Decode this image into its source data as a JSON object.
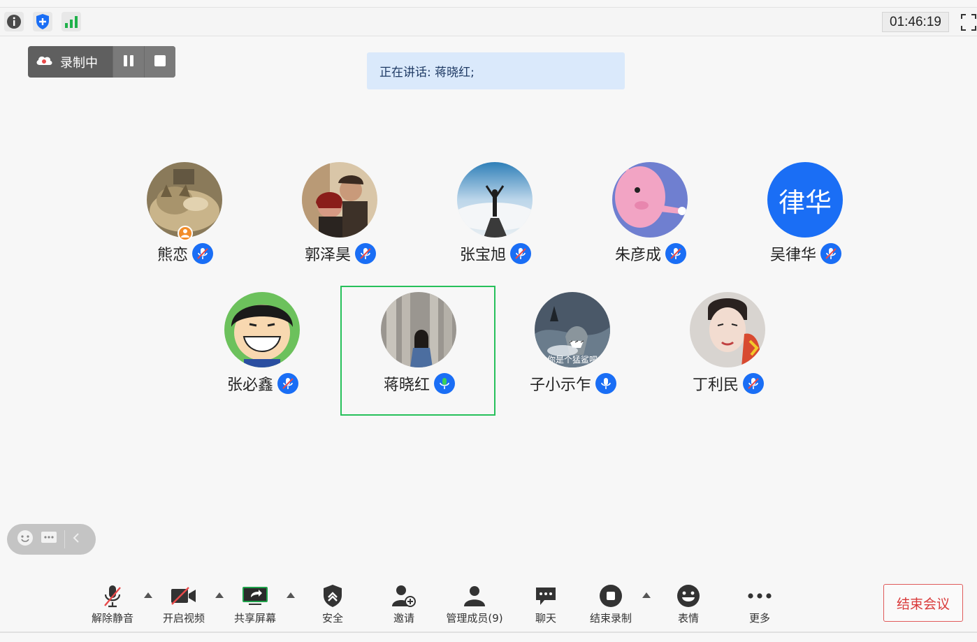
{
  "topbar": {
    "timer": "01:46:19",
    "icons": [
      "info-icon",
      "security-shield-icon",
      "signal-bars-icon",
      "fullscreen-icon"
    ]
  },
  "recording": {
    "status_label": "录制中",
    "pause": "pause-icon",
    "stop": "stop-icon"
  },
  "speaking_banner": "正在讲话: 蒋晓红;",
  "participants": [
    {
      "name": "熊恋",
      "mic": "muted",
      "host": true
    },
    {
      "name": "郭泽昊",
      "mic": "muted"
    },
    {
      "name": "张宝旭",
      "mic": "muted"
    },
    {
      "name": "朱彦成",
      "mic": "muted"
    },
    {
      "name": "吴律华",
      "mic": "muted",
      "avatar_text": "律华"
    },
    {
      "name": "张必鑫",
      "mic": "muted"
    },
    {
      "name": "蒋晓红",
      "mic": "speaking",
      "active": true
    },
    {
      "name": "子小示乍",
      "mic": "on",
      "avatar_caption": "你是个猛鲨吧"
    },
    {
      "name": "丁利民",
      "mic": "muted"
    }
  ],
  "toolbar": {
    "unmute": "解除静音",
    "video": "开启视频",
    "share": "共享屏幕",
    "security": "安全",
    "invite": "邀请",
    "members": "管理成员(9)",
    "chat": "聊天",
    "end_record": "结束录制",
    "reactions": "表情",
    "more": "更多",
    "end_meeting": "结束会议"
  },
  "colors": {
    "accent_blue": "#1a6ef5",
    "active_green": "#27c05b",
    "end_red": "#d93a3a",
    "banner_bg": "#dae9fb"
  }
}
